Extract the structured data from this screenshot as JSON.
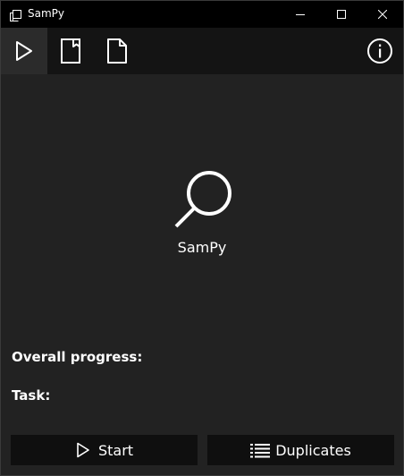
{
  "window": {
    "title": "SamPy",
    "icons": {
      "app": "restore-windows-icon",
      "minimize": "minimize-icon",
      "maximize": "maximize-icon",
      "close": "close-icon"
    }
  },
  "nav": {
    "tabs": [
      {
        "name": "run",
        "icon": "play-icon",
        "selected": true
      },
      {
        "name": "document-folded",
        "icon": "document-folded-icon",
        "selected": false
      },
      {
        "name": "document",
        "icon": "document-icon",
        "selected": false
      }
    ],
    "info_icon": "info-icon"
  },
  "main": {
    "logo_icon": "search-icon",
    "app_name": "SamPy",
    "overall_progress_label": "Overall progress:",
    "task_label": "Task:"
  },
  "buttons": {
    "start_label": "Start",
    "duplicates_label": "Duplicates"
  },
  "colors": {
    "titlebar": "#000000",
    "navbar": "#141414",
    "nav_selected": "#2b2b2b",
    "main_bg": "#222222",
    "button_bg": "#0f0f0f",
    "text": "#ffffff"
  }
}
